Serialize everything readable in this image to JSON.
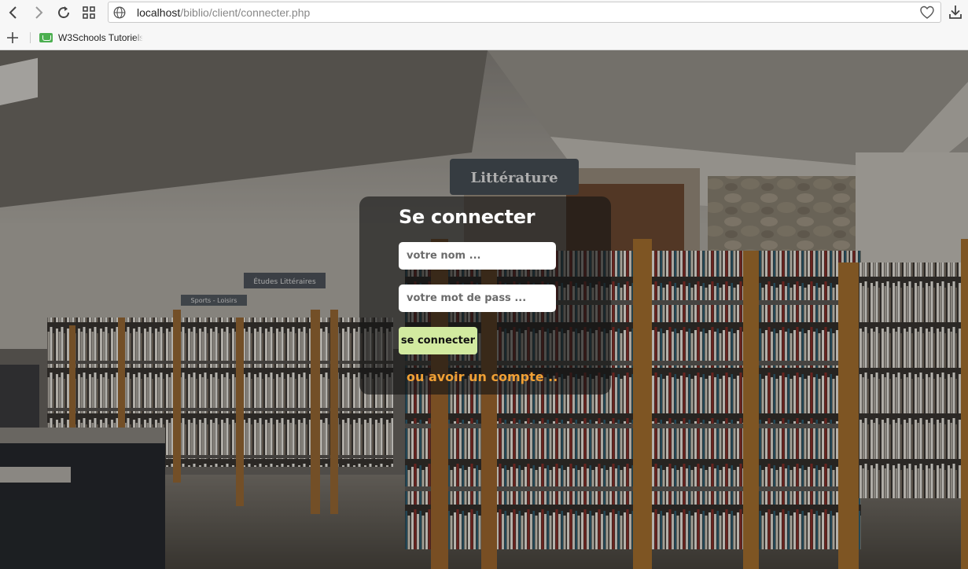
{
  "browser": {
    "url_host": "localhost",
    "url_path": "/biblio/client/connecter.php",
    "bookmarks": [
      {
        "label": "W3Schools Tutoriels"
      }
    ]
  },
  "page": {
    "signs": {
      "main": "Littérature",
      "secondary": "Études Littéraires",
      "tertiary": "Sports - Loisirs"
    },
    "login": {
      "title": "Se connecter",
      "name_placeholder": "votre nom ...",
      "password_placeholder": "votre mot de pass ...",
      "submit_label": "se connecter",
      "register_link": "ou avoir un compte .."
    }
  },
  "colors": {
    "submit_bg": "#d2eaa0",
    "link": "#f0a035"
  }
}
